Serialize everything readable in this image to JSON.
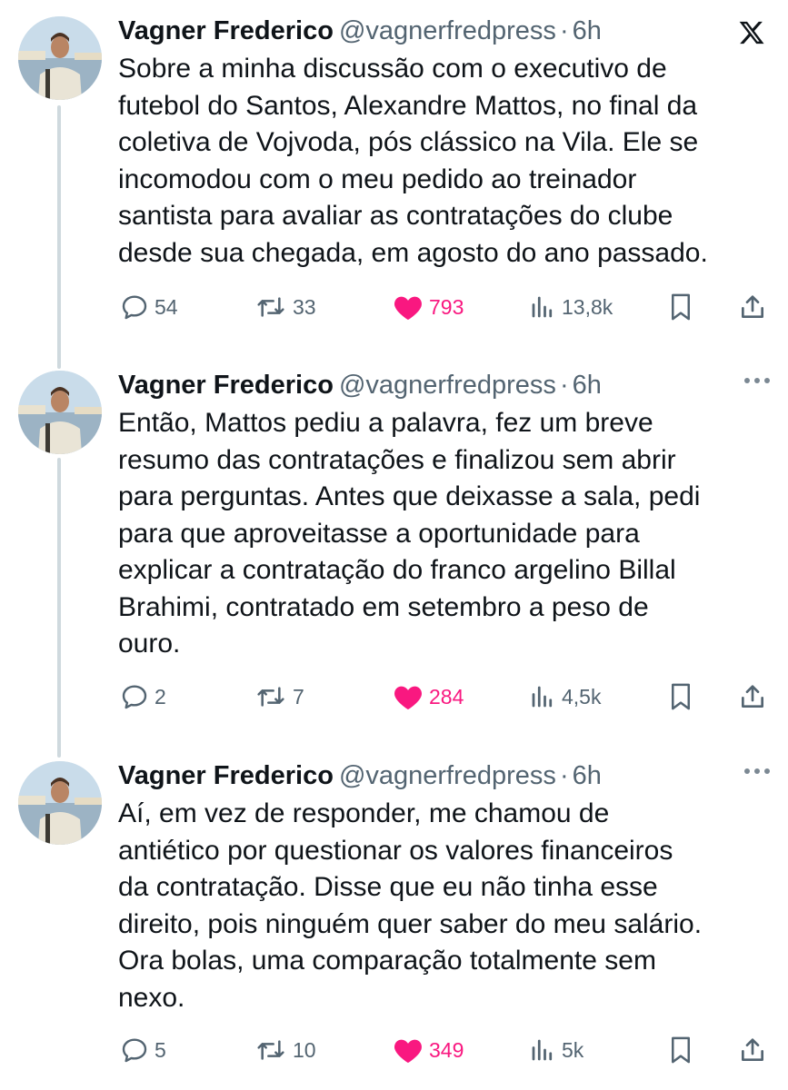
{
  "brand": {
    "logo_icon": "x-logo-icon"
  },
  "colors": {
    "text": "#0f1419",
    "secondary": "#536471",
    "like": "#f91880",
    "thread_line": "#cfd9de"
  },
  "tweets": [
    {
      "author": "Vagner Frederico",
      "handle": "@vagnerfredpress",
      "separator": "·",
      "time": "6h",
      "text": "Sobre a minha discussão com o executivo de\nfutebol do Santos, Alexandre Mattos, no final da\ncoletiva de Vojvoda, pós clássico na Vila. Ele se\nincomodou com o meu pedido ao treinador\nsantista para avaliar as contratações do clube\ndesde sua chegada, em agosto do ano passado.",
      "replies": "54",
      "reposts": "33",
      "likes": "793",
      "views": "13,8k"
    },
    {
      "author": "Vagner Frederico",
      "handle": "@vagnerfredpress",
      "separator": "·",
      "time": "6h",
      "text": "Então, Mattos pediu a palavra, fez um breve\nresumo das contratações e finalizou sem abrir\npara perguntas. Antes que deixasse a sala, pedi\npara que aproveitasse a oportunidade para\nexplicar a contratação do franco argelino Billal\nBrahimi, contratado em setembro a peso de\nouro.",
      "replies": "2",
      "reposts": "7",
      "likes": "284",
      "views": "4,5k"
    },
    {
      "author": "Vagner Frederico",
      "handle": "@vagnerfredpress",
      "separator": "·",
      "time": "6h",
      "text": "Aí, em vez de responder, me chamou de\nantiético por questionar os valores financeiros\nda contratação. Disse que eu não tinha esse\ndireito, pois ninguém quer saber do meu salário.\nOra bolas, uma comparação totalmente sem\nnexo.",
      "replies": "5",
      "reposts": "10",
      "likes": "349",
      "views": "5k"
    }
  ]
}
